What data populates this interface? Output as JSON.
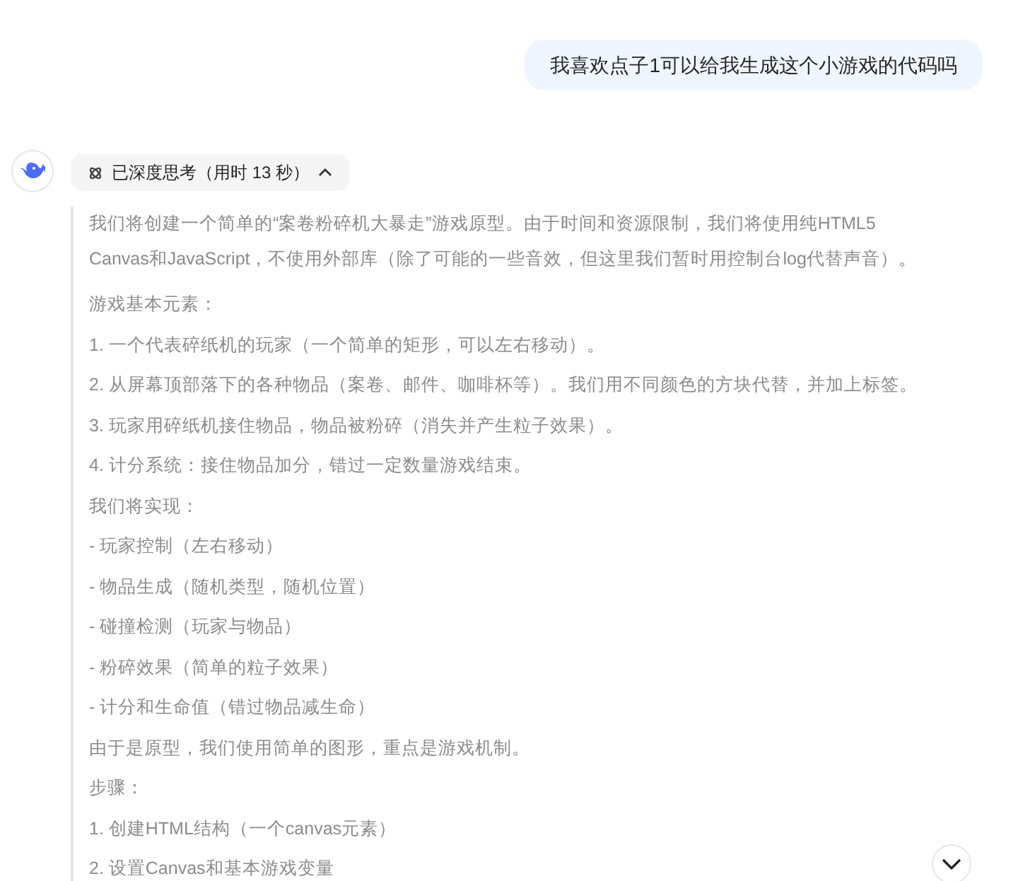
{
  "user_message": {
    "text": "我喜欢点子1可以给我生成这个小游戏的代码吗"
  },
  "thinking": {
    "label": "已深度思考（用时 13 秒）",
    "expanded": true,
    "paragraphs": [
      "我们将创建一个简单的“案卷粉碎机大暴走”游戏原型。由于时间和资源限制，我们将使用纯HTML5 Canvas和JavaScript，不使用外部库（除了可能的一些音效，但这里我们暂时用控制台log代替声音）。",
      "游戏基本元素：",
      "1. 一个代表碎纸机的玩家（一个简单的矩形，可以左右移动）。",
      "2. 从屏幕顶部落下的各种物品（案卷、邮件、咖啡杯等）。我们用不同颜色的方块代替，并加上标签。",
      "3. 玩家用碎纸机接住物品，物品被粉碎（消失并产生粒子效果）。",
      "4. 计分系统：接住物品加分，错过一定数量游戏结束。",
      "我们将实现：",
      "- 玩家控制（左右移动）",
      "- 物品生成（随机类型，随机位置）",
      "- 碰撞检测（玩家与物品）",
      "- 粉碎效果（简单的粒子效果）",
      "- 计分和生命值（错过物品减生命）",
      "由于是原型，我们使用简单的图形，重点是游戏机制。",
      "步骤：",
      "1. 创建HTML结构（一个canvas元素）",
      "2. 设置Canvas和基本游戏变量"
    ]
  }
}
